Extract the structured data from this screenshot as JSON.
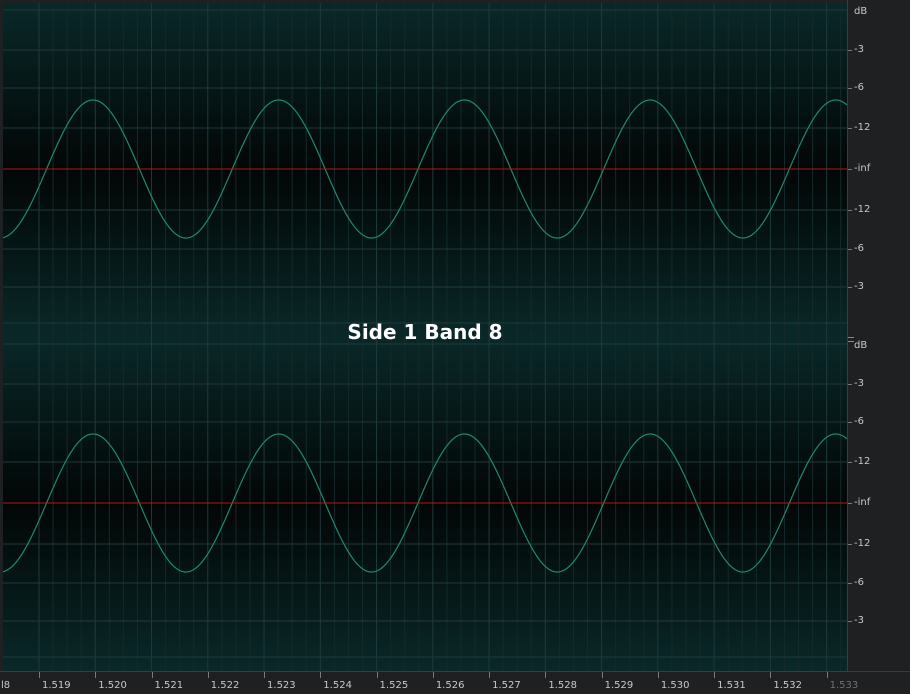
{
  "overlay_title": "Side 1 Band 8",
  "amplitude_ruler": {
    "unit_label": "dB",
    "lanes": [
      {
        "labels": [
          "-3",
          "-6",
          "-12",
          "-inf",
          "-12",
          "-6",
          "-3"
        ]
      },
      {
        "labels": [
          "-3",
          "-6",
          "-12",
          "-inf",
          "-12",
          "-6",
          "-3"
        ]
      }
    ]
  },
  "time_ruler": {
    "cut_label": "l8",
    "labels": [
      "1.519",
      "1.520",
      "1.521",
      "1.522",
      "1.523",
      "1.524",
      "1.525",
      "1.526",
      "1.527",
      "1.528",
      "1.529",
      "1.530",
      "1.531",
      "1.532",
      "1.533"
    ]
  },
  "colors": {
    "waveform": "#1f8a6a",
    "zero_line": "#b01818",
    "grid": "#1f3a3a",
    "background_center": "#082a2a",
    "background_edge": "#030506"
  }
}
